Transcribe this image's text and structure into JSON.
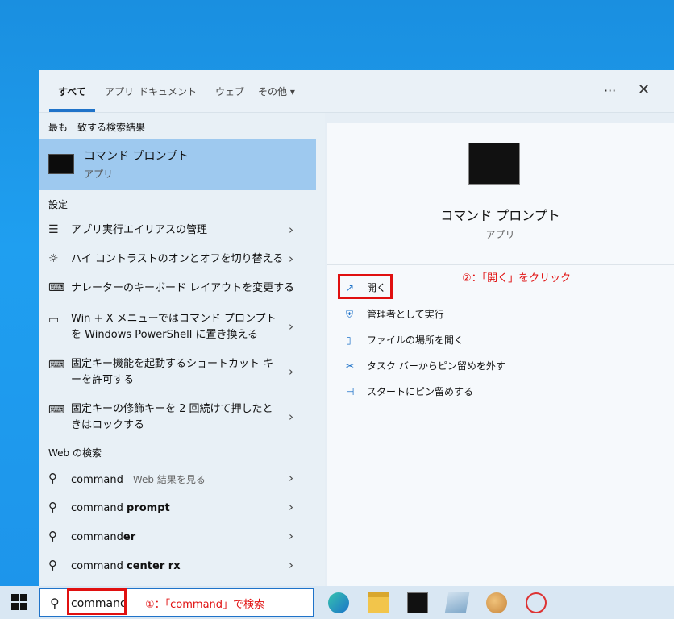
{
  "tabs": [
    {
      "label": "すべて"
    },
    {
      "label": "アプリ"
    },
    {
      "label": "ドキュメント"
    },
    {
      "label": "ウェブ"
    },
    {
      "label": "その他 ▾"
    }
  ],
  "header_icons": {
    "more": "···",
    "close": "✕"
  },
  "best_match": {
    "section": "最も一致する検索結果",
    "title": "コマンド プロンプト",
    "subtitle": "アプリ"
  },
  "settings": {
    "section": "設定",
    "items": [
      {
        "icon": "☰",
        "label": "アプリ実行エイリアスの管理"
      },
      {
        "icon": "☼",
        "label": "ハイ コントラストのオンとオフを切り替える"
      },
      {
        "icon": "⌨",
        "label": "ナレーターのキーボード レイアウトを変更する"
      },
      {
        "icon": "▭",
        "label": "Win + X メニューではコマンド プロンプトを Windows PowerShell に置き換える"
      },
      {
        "icon": "⌨",
        "label": "固定キー機能を起動するショートカット キーを許可する"
      },
      {
        "icon": "⌨",
        "label": "固定キーの修飾キーを 2 回続けて押したときはロックする"
      }
    ]
  },
  "web": {
    "section": "Web の検索",
    "items": [
      {
        "plain": "command",
        "suffix": " - Web 結果を見る",
        "bold": ""
      },
      {
        "plain": "command ",
        "suffix": "",
        "bold": "prompt"
      },
      {
        "plain": "command",
        "suffix": "",
        "bold": "er"
      },
      {
        "plain": "command ",
        "suffix": "",
        "bold": "center rx"
      }
    ]
  },
  "chevron": "›",
  "detail": {
    "title": "コマンド プロンプト",
    "subtitle": "アプリ",
    "actions": [
      {
        "icon": "↗",
        "label": "開く"
      },
      {
        "icon": "⛨",
        "label": "管理者として実行"
      },
      {
        "icon": "▯",
        "label": "ファイルの場所を開く"
      },
      {
        "icon": "✂",
        "label": "タスク バーからピン留めを外す"
      },
      {
        "icon": "⊣",
        "label": "スタートにピン留めする"
      }
    ]
  },
  "annotations": {
    "step2": "②：「開く」をクリック",
    "step1": "①：「command」で検索"
  },
  "search": {
    "value": "command"
  },
  "colors": {
    "accent": "#1f73c9",
    "highlight": "#9ec9ef",
    "annotation": "#e01010"
  }
}
